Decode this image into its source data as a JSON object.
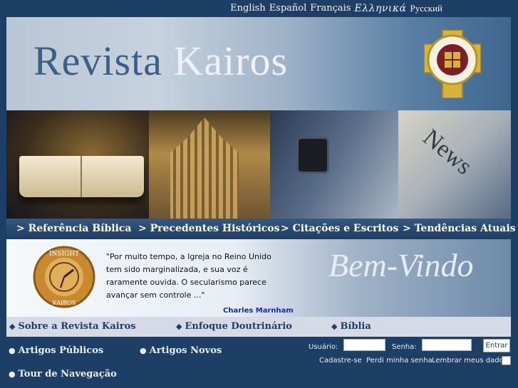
{
  "languages": [
    "English",
    "Español",
    "Français",
    "Ελληνικά",
    "Русский"
  ],
  "header": {
    "title_part1": "Revista",
    "title_part2": "Kairos"
  },
  "nav": {
    "items": [
      "> Referência Bíblica",
      "> Precedentes Históricos",
      "> Citações e Escritos",
      "> Tendências Atuais"
    ]
  },
  "welcome": {
    "quote": "\"Por muito tempo, a Igreja no Reino Unido tem sido marginalizada, e sua voz é raramente ouvida. O secularismo parece avançar sem controle ...\"",
    "author": "Charles Marnham",
    "greeting": "Bem-Vindo",
    "logo_top": "INSIGHT",
    "logo_bottom": "KAIROS"
  },
  "links": {
    "bullet": "◆",
    "top": [
      "Sobre a Revista Kairos",
      "Enfoque Doutrinário",
      "Bíblia"
    ],
    "bottom_bullet": "●",
    "bottom": [
      "Artigos Públicos",
      "Artigos Novos",
      "Tour de Navegação"
    ]
  },
  "login": {
    "user_label": "Usuário:",
    "pass_label": "Senha:",
    "submit": "Entrar",
    "register": "Cadastre-se",
    "forgot": "Perdi minha senha",
    "remember": "Lembrar meus dados"
  },
  "colors": {
    "page_bg": "#1d3f66",
    "nav_bg": "#2a4b72",
    "author": "#1a2aa8"
  }
}
